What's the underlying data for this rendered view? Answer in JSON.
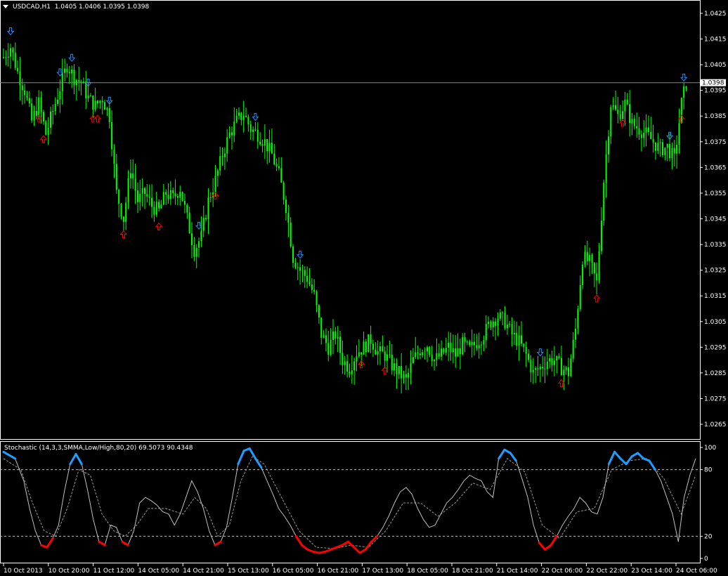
{
  "main": {
    "header": {
      "symbol_tf": "USDCAD,H1",
      "ohlc": "1.0405 1.0406 1.0395 1.0398"
    },
    "price_labels": [
      "1.0425",
      "1.0415",
      "1.0405",
      "1.0395",
      "1.0385",
      "1.0375",
      "1.0365",
      "1.0355",
      "1.0345",
      "1.0335",
      "1.0325",
      "1.0315",
      "1.0305",
      "1.0295",
      "1.0285",
      "1.0275",
      "1.0265"
    ],
    "current_price": "1.0398"
  },
  "indicator": {
    "title": "Stochastic (14,3,3,SMMA,Low/High,80,20) 69.5073 90.4348",
    "levels": [
      "100",
      "80",
      "20",
      "0"
    ]
  },
  "time_labels": [
    "10 Oct 2013",
    "10 Oct 20:00",
    "11 Oct 12:00",
    "14 Oct 05:00",
    "14 Oct 21:00",
    "15 Oct 13:00",
    "16 Oct 05:00",
    "16 Oct 21:00",
    "17 Oct 13:00",
    "18 Oct 05:00",
    "18 Oct 21:00",
    "21 Oct 14:00",
    "22 Oct 06:00",
    "22 Oct 22:00",
    "23 Oct 14:00",
    "24 Oct 06:00"
  ],
  "colors": {
    "background": "#000000",
    "candles": "#00ff00",
    "arrow_up": "#ff0000",
    "arrow_down": "#1e90ff",
    "stoch_main": "#c0c0c0",
    "overbought": "#1e9fff",
    "oversold": "#ff0000"
  },
  "chart_data": {
    "type": "candlestick",
    "ylim": [
      1.0262,
      1.0428
    ],
    "close_path": [
      [
        0,
        1.0408
      ],
      [
        3,
        1.0412
      ],
      [
        6,
        1.0402
      ],
      [
        9,
        1.0395
      ],
      [
        12,
        1.0383
      ],
      [
        15,
        1.039
      ],
      [
        18,
        1.0378
      ],
      [
        21,
        1.0387
      ],
      [
        24,
        1.0396
      ],
      [
        27,
        1.0405
      ],
      [
        30,
        1.04
      ],
      [
        33,
        1.0398
      ],
      [
        36,
        1.0392
      ],
      [
        39,
        1.0389
      ],
      [
        42,
        1.0392
      ],
      [
        45,
        1.0385
      ],
      [
        48,
        1.0355
      ],
      [
        51,
        1.0345
      ],
      [
        54,
        1.0365
      ],
      [
        57,
        1.0352
      ],
      [
        60,
        1.0355
      ],
      [
        63,
        1.035
      ],
      [
        66,
        1.0348
      ],
      [
        69,
        1.0355
      ],
      [
        72,
        1.0353
      ],
      [
        75,
        1.0357
      ],
      [
        78,
        1.0345
      ],
      [
        81,
        1.0333
      ],
      [
        84,
        1.0338
      ],
      [
        87,
        1.0352
      ],
      [
        90,
        1.036
      ],
      [
        93,
        1.037
      ],
      [
        96,
        1.0378
      ],
      [
        99,
        1.0383
      ],
      [
        102,
        1.0386
      ],
      [
        105,
        1.038
      ],
      [
        108,
        1.0378
      ],
      [
        111,
        1.0375
      ],
      [
        114,
        1.037
      ],
      [
        117,
        1.0362
      ],
      [
        120,
        1.035
      ],
      [
        123,
        1.033
      ],
      [
        126,
        1.0325
      ],
      [
        129,
        1.0322
      ],
      [
        132,
        1.0315
      ],
      [
        135,
        1.03
      ],
      [
        138,
        1.0295
      ],
      [
        141,
        1.03
      ],
      [
        144,
        1.029
      ],
      [
        147,
        1.0287
      ],
      [
        150,
        1.0293
      ],
      [
        153,
        1.0295
      ],
      [
        156,
        1.0298
      ],
      [
        159,
        1.0293
      ],
      [
        162,
        1.0292
      ],
      [
        165,
        1.0288
      ],
      [
        168,
        1.0285
      ],
      [
        171,
        1.0282
      ],
      [
        174,
        1.029
      ],
      [
        177,
        1.0294
      ],
      [
        180,
        1.0296
      ],
      [
        183,
        1.029
      ],
      [
        186,
        1.0292
      ],
      [
        189,
        1.0295
      ],
      [
        192,
        1.0292
      ],
      [
        195,
        1.0296
      ],
      [
        198,
        1.0294
      ],
      [
        201,
        1.0297
      ],
      [
        204,
        1.03
      ],
      [
        207,
        1.0305
      ],
      [
        210,
        1.0307
      ],
      [
        213,
        1.0305
      ],
      [
        216,
        1.03
      ],
      [
        219,
        1.0297
      ],
      [
        222,
        1.0292
      ],
      [
        225,
        1.0285
      ],
      [
        228,
        1.0287
      ],
      [
        231,
        1.029
      ],
      [
        234,
        1.029
      ],
      [
        237,
        1.0287
      ],
      [
        240,
        1.0285
      ],
      [
        243,
        1.0302
      ],
      [
        246,
        1.033
      ],
      [
        249,
        1.0328
      ],
      [
        252,
        1.032
      ],
      [
        255,
        1.036
      ],
      [
        258,
        1.039
      ],
      [
        261,
        1.0385
      ],
      [
        264,
        1.039
      ],
      [
        267,
        1.0382
      ],
      [
        270,
        1.038
      ],
      [
        273,
        1.0378
      ],
      [
        276,
        1.0375
      ],
      [
        279,
        1.0372
      ],
      [
        282,
        1.0373
      ],
      [
        285,
        1.0368
      ],
      [
        288,
        1.039
      ],
      [
        290,
        1.0398
      ]
    ],
    "current_price": 1.0398
  },
  "indicator_data": {
    "type": "line",
    "ylim": [
      0,
      100
    ],
    "levels": [
      80,
      20
    ],
    "k": [
      [
        0,
        96
      ],
      [
        4,
        90
      ],
      [
        7,
        70
      ],
      [
        9,
        45
      ],
      [
        11,
        25
      ],
      [
        13,
        12
      ],
      [
        15,
        10
      ],
      [
        17,
        18
      ],
      [
        19,
        30
      ],
      [
        21,
        60
      ],
      [
        23,
        85
      ],
      [
        25,
        94
      ],
      [
        27,
        85
      ],
      [
        29,
        62
      ],
      [
        31,
        35
      ],
      [
        33,
        15
      ],
      [
        35,
        12
      ],
      [
        37,
        30
      ],
      [
        39,
        28
      ],
      [
        41,
        15
      ],
      [
        43,
        12
      ],
      [
        45,
        25
      ],
      [
        47,
        50
      ],
      [
        49,
        55
      ],
      [
        51,
        52
      ],
      [
        53,
        48
      ],
      [
        55,
        42
      ],
      [
        57,
        40
      ],
      [
        59,
        30
      ],
      [
        61,
        40
      ],
      [
        63,
        55
      ],
      [
        65,
        70
      ],
      [
        67,
        60
      ],
      [
        69,
        45
      ],
      [
        71,
        25
      ],
      [
        73,
        12
      ],
      [
        75,
        15
      ],
      [
        77,
        28
      ],
      [
        79,
        55
      ],
      [
        81,
        85
      ],
      [
        83,
        97
      ],
      [
        85,
        99
      ],
      [
        87,
        90
      ],
      [
        89,
        82
      ],
      [
        91,
        70
      ],
      [
        93,
        58
      ],
      [
        95,
        45
      ],
      [
        97,
        38
      ],
      [
        99,
        30
      ],
      [
        101,
        20
      ],
      [
        103,
        12
      ],
      [
        105,
        8
      ],
      [
        107,
        6
      ],
      [
        109,
        5
      ],
      [
        111,
        6
      ],
      [
        113,
        8
      ],
      [
        115,
        10
      ],
      [
        117,
        12
      ],
      [
        119,
        15
      ],
      [
        121,
        10
      ],
      [
        123,
        5
      ],
      [
        125,
        8
      ],
      [
        127,
        15
      ],
      [
        129,
        20
      ],
      [
        131,
        28
      ],
      [
        133,
        38
      ],
      [
        135,
        50
      ],
      [
        137,
        60
      ],
      [
        139,
        64
      ],
      [
        141,
        58
      ],
      [
        143,
        45
      ],
      [
        145,
        35
      ],
      [
        147,
        28
      ],
      [
        149,
        30
      ],
      [
        151,
        40
      ],
      [
        153,
        50
      ],
      [
        155,
        55
      ],
      [
        157,
        62
      ],
      [
        159,
        70
      ],
      [
        161,
        75
      ],
      [
        163,
        72
      ],
      [
        165,
        70
      ],
      [
        167,
        60
      ],
      [
        169,
        55
      ],
      [
        171,
        90
      ],
      [
        173,
        98
      ],
      [
        175,
        95
      ],
      [
        177,
        88
      ],
      [
        179,
        72
      ],
      [
        181,
        55
      ],
      [
        183,
        30
      ],
      [
        185,
        14
      ],
      [
        187,
        8
      ],
      [
        189,
        12
      ],
      [
        191,
        20
      ],
      [
        193,
        30
      ],
      [
        195,
        38
      ],
      [
        197,
        45
      ],
      [
        199,
        55
      ],
      [
        201,
        50
      ],
      [
        203,
        42
      ],
      [
        205,
        40
      ],
      [
        207,
        55
      ],
      [
        209,
        85
      ],
      [
        211,
        96
      ],
      [
        213,
        90
      ],
      [
        215,
        85
      ],
      [
        217,
        92
      ],
      [
        219,
        95
      ],
      [
        221,
        90
      ],
      [
        223,
        88
      ],
      [
        225,
        80
      ],
      [
        227,
        70
      ],
      [
        229,
        55
      ],
      [
        231,
        40
      ],
      [
        233,
        15
      ],
      [
        235,
        55
      ],
      [
        237,
        75
      ],
      [
        239,
        90
      ]
    ],
    "d": [
      [
        0,
        90
      ],
      [
        6,
        80
      ],
      [
        10,
        50
      ],
      [
        14,
        25
      ],
      [
        18,
        20
      ],
      [
        22,
        45
      ],
      [
        26,
        80
      ],
      [
        30,
        75
      ],
      [
        34,
        40
      ],
      [
        38,
        25
      ],
      [
        42,
        20
      ],
      [
        46,
        30
      ],
      [
        50,
        45
      ],
      [
        56,
        45
      ],
      [
        62,
        40
      ],
      [
        66,
        55
      ],
      [
        70,
        45
      ],
      [
        74,
        20
      ],
      [
        78,
        30
      ],
      [
        82,
        70
      ],
      [
        86,
        92
      ],
      [
        90,
        85
      ],
      [
        96,
        55
      ],
      [
        102,
        25
      ],
      [
        108,
        10
      ],
      [
        114,
        9
      ],
      [
        120,
        12
      ],
      [
        126,
        10
      ],
      [
        132,
        25
      ],
      [
        138,
        50
      ],
      [
        144,
        50
      ],
      [
        150,
        38
      ],
      [
        156,
        50
      ],
      [
        162,
        68
      ],
      [
        168,
        62
      ],
      [
        174,
        90
      ],
      [
        180,
        78
      ],
      [
        186,
        30
      ],
      [
        192,
        18
      ],
      [
        198,
        42
      ],
      [
        204,
        45
      ],
      [
        210,
        80
      ],
      [
        216,
        88
      ],
      [
        222,
        90
      ],
      [
        228,
        72
      ],
      [
        234,
        40
      ],
      [
        239,
        75
      ]
    ]
  }
}
